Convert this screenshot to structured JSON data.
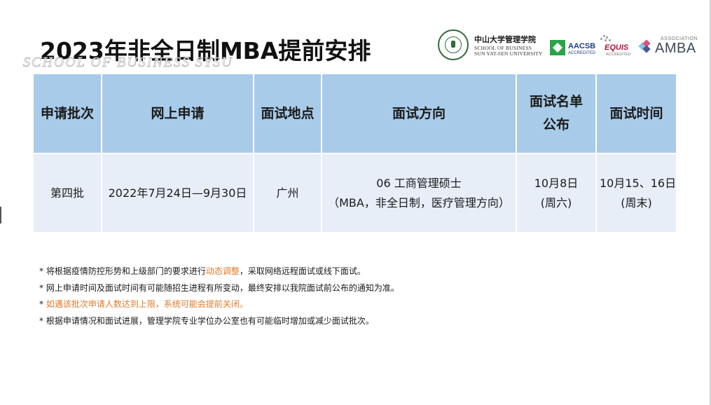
{
  "title": "2023年非全日制MBA提前安排",
  "watermark": "SCHOOL OF BUSINESS SYSU",
  "logos": {
    "school_cn": "中山大学管理学院",
    "school_en_line1": "SCHOOL OF BUSINESS",
    "school_en_line2": "SUN YAT-SEN UNIVERSITY",
    "aacsb": "AACSB",
    "aacsb_sub": "ACCREDITED",
    "equis": "EQUIS",
    "equis_sub": "ACCREDITED",
    "amba_assoc": "ASSOCIATION",
    "amba": "AMBA",
    "colors": {
      "aacsb_green": "#2aa34a",
      "equis_red": "#b3123a",
      "sysu_green": "#2f6b3a"
    }
  },
  "table": {
    "headers": [
      "申请批次",
      "网上申请",
      "面试地点",
      "面试方向",
      [
        "面试名单",
        "公布"
      ],
      "面试时间"
    ],
    "rows": [
      {
        "batch": "第四批",
        "online": "2022年7月24日—9月30日",
        "location": "广州",
        "direction": [
          "06 工商管理硕士",
          "（MBA，非全日制，医疗管理方向）"
        ],
        "list_publish": [
          "10月8日",
          "(周六)"
        ],
        "interview_time": [
          "10月15、16日",
          "(周末)"
        ]
      }
    ],
    "colors": {
      "header_bg": "#a8cbe9",
      "row_bg": "#e7eef8"
    }
  },
  "notes": [
    {
      "pre": "* 将根据疫情防控形势和上级部门的要求进行",
      "highlight": "动态调整",
      "post": "，采取网络远程面试或线下面试。"
    },
    {
      "pre": "* 网上申请时间及面试时间有可能随招生进程有所变动，最终安排以我院面试前公布的通知为准。",
      "highlight": "",
      "post": ""
    },
    {
      "pre": "* ",
      "highlight": "如遇该批次申请人数达到上限，系统可能会提前关闭",
      "post": "。"
    },
    {
      "pre": "* 根据申请情况和面试进展，管理学院专业学位办公室也有可能临时增加或减少面试批次。",
      "highlight": "",
      "post": ""
    }
  ],
  "highlight_color": "#e07b2a"
}
